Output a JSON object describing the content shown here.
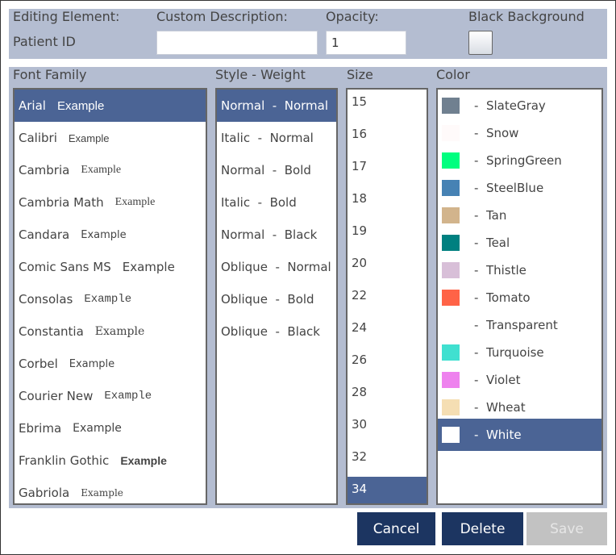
{
  "header": {
    "editing_label": "Editing Element:",
    "element_name": "Patient ID",
    "custom_description_label": "Custom Description:",
    "custom_description_value": "",
    "opacity_label": "Opacity:",
    "opacity_value": "1",
    "black_background_label": "Black Background"
  },
  "columns": {
    "font_family": "Font Family",
    "style_weight": "Style - Weight",
    "size": "Size",
    "color": "Color"
  },
  "fonts": [
    {
      "name": "Arial",
      "example": "Example",
      "selected": true
    },
    {
      "name": "Calibri",
      "example": "Example"
    },
    {
      "name": "Cambria",
      "example": "Example"
    },
    {
      "name": "Cambria Math",
      "example": "Example"
    },
    {
      "name": "Candara",
      "example": "Example"
    },
    {
      "name": "Comic Sans MS",
      "example": "Example"
    },
    {
      "name": "Consolas",
      "example": "Example"
    },
    {
      "name": "Constantia",
      "example": "Example"
    },
    {
      "name": "Corbel",
      "example": "Example"
    },
    {
      "name": "Courier New",
      "example": "Example"
    },
    {
      "name": "Ebrima",
      "example": "Example"
    },
    {
      "name": "Franklin Gothic",
      "example": "Example"
    },
    {
      "name": "Gabriola",
      "example": "Example"
    }
  ],
  "styles": [
    {
      "label": "Normal  -  Normal",
      "selected": true
    },
    {
      "label": "Italic  -  Normal"
    },
    {
      "label": "Normal  -  Bold"
    },
    {
      "label": "Italic  -  Bold"
    },
    {
      "label": "Normal  -  Black"
    },
    {
      "label": "Oblique  -  Normal"
    },
    {
      "label": "Oblique  -  Bold"
    },
    {
      "label": "Oblique  -  Black"
    }
  ],
  "sizes": [
    {
      "label": "15"
    },
    {
      "label": "16"
    },
    {
      "label": "17"
    },
    {
      "label": "18"
    },
    {
      "label": "19"
    },
    {
      "label": "20"
    },
    {
      "label": "22"
    },
    {
      "label": "24"
    },
    {
      "label": "26"
    },
    {
      "label": "28"
    },
    {
      "label": "30"
    },
    {
      "label": "32"
    },
    {
      "label": "34",
      "selected": true
    }
  ],
  "colors": [
    {
      "label": "-  SlateGray",
      "hex": "#708090"
    },
    {
      "label": "-  Snow",
      "hex": "#fffafa"
    },
    {
      "label": "-  SpringGreen",
      "hex": "#00ff7f"
    },
    {
      "label": "-  SteelBlue",
      "hex": "#4682b4"
    },
    {
      "label": "-  Tan",
      "hex": "#d2b48c"
    },
    {
      "label": "-  Teal",
      "hex": "#008080"
    },
    {
      "label": "-  Thistle",
      "hex": "#d8bfd8"
    },
    {
      "label": "-  Tomato",
      "hex": "#ff6347"
    },
    {
      "label": "-  Transparent",
      "hex": "transparent"
    },
    {
      "label": "-  Turquoise",
      "hex": "#40e0d0"
    },
    {
      "label": "-  Violet",
      "hex": "#ee82ee"
    },
    {
      "label": "-  Wheat",
      "hex": "#f5deb3"
    },
    {
      "label": "-  White",
      "hex": "#ffffff",
      "selected": true
    }
  ],
  "buttons": {
    "cancel": "Cancel",
    "delete": "Delete",
    "save": "Save"
  },
  "theme": {
    "panel": "#b4bdd1",
    "selection": "#4b6495",
    "button": "#1c3561",
    "button_disabled": "#c2c2c2"
  }
}
